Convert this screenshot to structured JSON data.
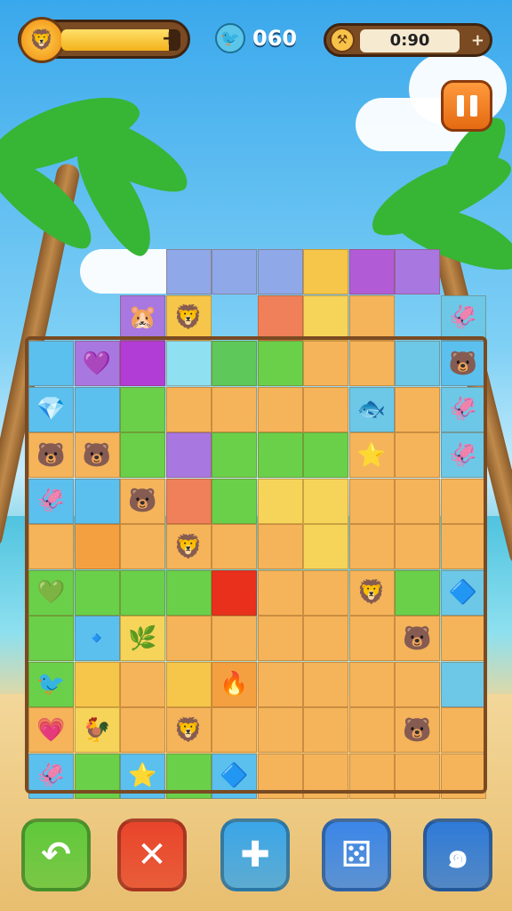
{
  "hud": {
    "energy_plus": "+",
    "energy_fill": 0.9,
    "counter": "060",
    "timer": "0:90",
    "timer_plus": "+"
  },
  "icons": {
    "avatar": "lion-avatar-icon",
    "counter": "bird-icon",
    "timer": "hammer-icon",
    "pause": "pause-icon"
  },
  "board": {
    "cols": 10,
    "rows": 12,
    "tiles": [
      {
        "c": 3,
        "r": 0,
        "color": "#8fa8e8",
        "g": ""
      },
      {
        "c": 4,
        "r": 0,
        "color": "#8fa8e8",
        "g": ""
      },
      {
        "c": 5,
        "r": 0,
        "color": "#8fa8e8",
        "g": ""
      },
      {
        "c": 6,
        "r": 0,
        "color": "#f6c64a",
        "g": ""
      },
      {
        "c": 7,
        "r": 0,
        "color": "#b15cd6",
        "g": ""
      },
      {
        "c": 8,
        "r": 0,
        "color": "#a877e0",
        "g": ""
      },
      {
        "c": 2,
        "r": 1,
        "color": "#a877e0",
        "g": "🐹"
      },
      {
        "c": 3,
        "r": 1,
        "color": "#f6c64a",
        "g": "🦁"
      },
      {
        "c": 5,
        "r": 1,
        "color": "#f0805a",
        "g": ""
      },
      {
        "c": 6,
        "r": 1,
        "color": "#f6d45a",
        "g": ""
      },
      {
        "c": 7,
        "r": 1,
        "color": "#f5b45a",
        "g": ""
      },
      {
        "c": 9,
        "r": 1,
        "color": "#6cc8e6",
        "g": "🦑"
      },
      {
        "c": 0,
        "r": 2,
        "color": "#5bc0ee",
        "g": ""
      },
      {
        "c": 1,
        "r": 2,
        "color": "#a877e0",
        "g": "💜"
      },
      {
        "c": 2,
        "r": 2,
        "color": "#b13cd6",
        "g": ""
      },
      {
        "c": 3,
        "r": 2,
        "color": "#8fe0f0",
        "g": ""
      },
      {
        "c": 4,
        "r": 2,
        "color": "#5ec85a",
        "g": ""
      },
      {
        "c": 5,
        "r": 2,
        "color": "#6ad04a",
        "g": ""
      },
      {
        "c": 6,
        "r": 2,
        "color": "#f5b45a",
        "g": ""
      },
      {
        "c": 7,
        "r": 2,
        "color": "#f5b45a",
        "g": ""
      },
      {
        "c": 8,
        "r": 2,
        "color": "#6cc8e6",
        "g": ""
      },
      {
        "c": 9,
        "r": 2,
        "color": "#5bc0ee",
        "g": "🐻"
      },
      {
        "c": 0,
        "r": 3,
        "color": "#5bc0ee",
        "g": "💎"
      },
      {
        "c": 1,
        "r": 3,
        "color": "#5bc0ee",
        "g": ""
      },
      {
        "c": 2,
        "r": 3,
        "color": "#6ad04a",
        "g": ""
      },
      {
        "c": 3,
        "r": 3,
        "color": "#f5b45a",
        "g": ""
      },
      {
        "c": 4,
        "r": 3,
        "color": "#f5b45a",
        "g": ""
      },
      {
        "c": 5,
        "r": 3,
        "color": "#f5b45a",
        "g": ""
      },
      {
        "c": 6,
        "r": 3,
        "color": "#f5b45a",
        "g": ""
      },
      {
        "c": 7,
        "r": 3,
        "color": "#6cc8e6",
        "g": "🐟"
      },
      {
        "c": 8,
        "r": 3,
        "color": "#f5b45a",
        "g": ""
      },
      {
        "c": 9,
        "r": 3,
        "color": "#6cc8e6",
        "g": "🦑"
      },
      {
        "c": 0,
        "r": 4,
        "color": "#f5b45a",
        "g": "🐻"
      },
      {
        "c": 1,
        "r": 4,
        "color": "#f5b45a",
        "g": "🐻"
      },
      {
        "c": 2,
        "r": 4,
        "color": "#6ad04a",
        "g": ""
      },
      {
        "c": 3,
        "r": 4,
        "color": "#a877e0",
        "g": ""
      },
      {
        "c": 4,
        "r": 4,
        "color": "#6ad04a",
        "g": ""
      },
      {
        "c": 5,
        "r": 4,
        "color": "#6ad04a",
        "g": ""
      },
      {
        "c": 6,
        "r": 4,
        "color": "#6ad04a",
        "g": ""
      },
      {
        "c": 7,
        "r": 4,
        "color": "#f5b45a",
        "g": "⭐"
      },
      {
        "c": 8,
        "r": 4,
        "color": "#f5b45a",
        "g": ""
      },
      {
        "c": 9,
        "r": 4,
        "color": "#6cc8e6",
        "g": "🦑"
      },
      {
        "c": 0,
        "r": 5,
        "color": "#5bc0ee",
        "g": "🦑"
      },
      {
        "c": 1,
        "r": 5,
        "color": "#5bc0ee",
        "g": ""
      },
      {
        "c": 2,
        "r": 5,
        "color": "#f5b45a",
        "g": "🐻"
      },
      {
        "c": 3,
        "r": 5,
        "color": "#f0805a",
        "g": ""
      },
      {
        "c": 4,
        "r": 5,
        "color": "#6ad04a",
        "g": ""
      },
      {
        "c": 5,
        "r": 5,
        "color": "#f6d45a",
        "g": ""
      },
      {
        "c": 6,
        "r": 5,
        "color": "#f6d45a",
        "g": ""
      },
      {
        "c": 7,
        "r": 5,
        "color": "#f5b45a",
        "g": ""
      },
      {
        "c": 8,
        "r": 5,
        "color": "#f5b45a",
        "g": ""
      },
      {
        "c": 9,
        "r": 5,
        "color": "#f5b45a",
        "g": ""
      },
      {
        "c": 0,
        "r": 6,
        "color": "#f5b45a",
        "g": ""
      },
      {
        "c": 1,
        "r": 6,
        "color": "#f5a040",
        "g": ""
      },
      {
        "c": 2,
        "r": 6,
        "color": "#f5b45a",
        "g": ""
      },
      {
        "c": 3,
        "r": 6,
        "color": "#f5b45a",
        "g": "🦁"
      },
      {
        "c": 4,
        "r": 6,
        "color": "#f5b45a",
        "g": ""
      },
      {
        "c": 5,
        "r": 6,
        "color": "#f5b45a",
        "g": ""
      },
      {
        "c": 6,
        "r": 6,
        "color": "#f6d45a",
        "g": ""
      },
      {
        "c": 7,
        "r": 6,
        "color": "#f5b45a",
        "g": ""
      },
      {
        "c": 8,
        "r": 6,
        "color": "#f5b45a",
        "g": ""
      },
      {
        "c": 9,
        "r": 6,
        "color": "#f5b45a",
        "g": ""
      },
      {
        "c": 0,
        "r": 7,
        "color": "#6ad04a",
        "g": "💚"
      },
      {
        "c": 1,
        "r": 7,
        "color": "#6ad04a",
        "g": ""
      },
      {
        "c": 2,
        "r": 7,
        "color": "#6ad04a",
        "g": ""
      },
      {
        "c": 3,
        "r": 7,
        "color": "#6ad04a",
        "g": ""
      },
      {
        "c": 4,
        "r": 7,
        "color": "#e8301c",
        "g": ""
      },
      {
        "c": 5,
        "r": 7,
        "color": "#f5b45a",
        "g": ""
      },
      {
        "c": 6,
        "r": 7,
        "color": "#f5b45a",
        "g": ""
      },
      {
        "c": 7,
        "r": 7,
        "color": "#f5b45a",
        "g": "🦁"
      },
      {
        "c": 8,
        "r": 7,
        "color": "#6ad04a",
        "g": ""
      },
      {
        "c": 9,
        "r": 7,
        "color": "#6cc8e6",
        "g": "🔷"
      },
      {
        "c": 0,
        "r": 8,
        "color": "#6ad04a",
        "g": ""
      },
      {
        "c": 1,
        "r": 8,
        "color": "#5bc0ee",
        "g": "🔹"
      },
      {
        "c": 2,
        "r": 8,
        "color": "#f6d45a",
        "g": "🌿"
      },
      {
        "c": 3,
        "r": 8,
        "color": "#f5b45a",
        "g": ""
      },
      {
        "c": 4,
        "r": 8,
        "color": "#f5b45a",
        "g": ""
      },
      {
        "c": 5,
        "r": 8,
        "color": "#f5b45a",
        "g": ""
      },
      {
        "c": 6,
        "r": 8,
        "color": "#f5b45a",
        "g": ""
      },
      {
        "c": 7,
        "r": 8,
        "color": "#f5b45a",
        "g": ""
      },
      {
        "c": 8,
        "r": 8,
        "color": "#f5b45a",
        "g": "🐻"
      },
      {
        "c": 9,
        "r": 8,
        "color": "#f5b45a",
        "g": ""
      },
      {
        "c": 0,
        "r": 9,
        "color": "#6ad04a",
        "g": "🐦"
      },
      {
        "c": 1,
        "r": 9,
        "color": "#f6c64a",
        "g": ""
      },
      {
        "c": 2,
        "r": 9,
        "color": "#f5b45a",
        "g": ""
      },
      {
        "c": 3,
        "r": 9,
        "color": "#f6c64a",
        "g": ""
      },
      {
        "c": 4,
        "r": 9,
        "color": "#f5a040",
        "g": "🔥"
      },
      {
        "c": 5,
        "r": 9,
        "color": "#f5b45a",
        "g": ""
      },
      {
        "c": 6,
        "r": 9,
        "color": "#f5b45a",
        "g": ""
      },
      {
        "c": 7,
        "r": 9,
        "color": "#f5b45a",
        "g": ""
      },
      {
        "c": 8,
        "r": 9,
        "color": "#f5b45a",
        "g": ""
      },
      {
        "c": 9,
        "r": 9,
        "color": "#6cc8e6",
        "g": ""
      },
      {
        "c": 0,
        "r": 10,
        "color": "#f5b45a",
        "g": "💗"
      },
      {
        "c": 1,
        "r": 10,
        "color": "#f6d45a",
        "g": "🐓"
      },
      {
        "c": 2,
        "r": 10,
        "color": "#f5b45a",
        "g": ""
      },
      {
        "c": 3,
        "r": 10,
        "color": "#f5b45a",
        "g": "🦁"
      },
      {
        "c": 4,
        "r": 10,
        "color": "#f5b45a",
        "g": ""
      },
      {
        "c": 5,
        "r": 10,
        "color": "#f5b45a",
        "g": ""
      },
      {
        "c": 6,
        "r": 10,
        "color": "#f5b45a",
        "g": ""
      },
      {
        "c": 7,
        "r": 10,
        "color": "#f5b45a",
        "g": ""
      },
      {
        "c": 8,
        "r": 10,
        "color": "#f5b45a",
        "g": "🐻"
      },
      {
        "c": 9,
        "r": 10,
        "color": "#f5b45a",
        "g": ""
      },
      {
        "c": 0,
        "r": 11,
        "color": "#5bc0ee",
        "g": "🦑"
      },
      {
        "c": 1,
        "r": 11,
        "color": "#6ad04a",
        "g": ""
      },
      {
        "c": 2,
        "r": 11,
        "color": "#5bc0ee",
        "g": "⭐"
      },
      {
        "c": 3,
        "r": 11,
        "color": "#6ad04a",
        "g": ""
      },
      {
        "c": 4,
        "r": 11,
        "color": "#5bc0ee",
        "g": "🔷"
      },
      {
        "c": 5,
        "r": 11,
        "color": "#f5b45a",
        "g": ""
      },
      {
        "c": 6,
        "r": 11,
        "color": "#f5b45a",
        "g": ""
      },
      {
        "c": 7,
        "r": 11,
        "color": "#f5b45a",
        "g": ""
      },
      {
        "c": 8,
        "r": 11,
        "color": "#f5b45a",
        "g": ""
      },
      {
        "c": 9,
        "r": 11,
        "color": "#f5b45a",
        "g": ""
      }
    ]
  },
  "toolbar": [
    {
      "name": "undo-button",
      "icon": "undo-icon",
      "glyph": "↶",
      "color": "#5fc83a"
    },
    {
      "name": "remove-button",
      "icon": "cross-icon",
      "glyph": "✕",
      "color": "#e8442a"
    },
    {
      "name": "hammer-button",
      "icon": "tool-icon",
      "glyph": "✚",
      "color": "#3aa6e8"
    },
    {
      "name": "shuffle-button",
      "icon": "dice-icon",
      "glyph": "⚄",
      "color": "#3a86e8"
    },
    {
      "name": "hint-button",
      "icon": "swirl-icon",
      "glyph": "๑",
      "color": "#2e7ad8"
    }
  ]
}
